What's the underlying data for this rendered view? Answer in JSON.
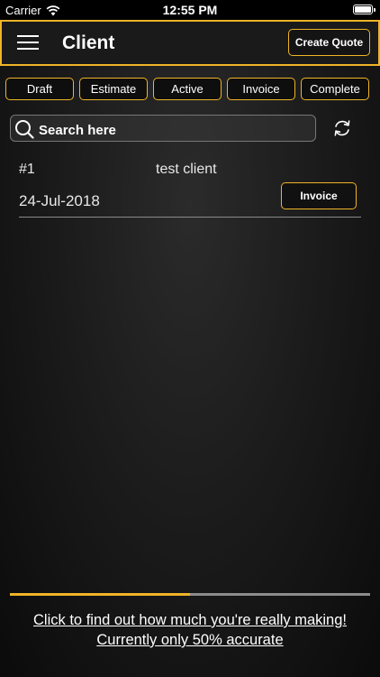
{
  "status_bar": {
    "carrier": "Carrier",
    "time": "12:55 PM",
    "icons": [
      "wifi-icon",
      "battery-icon"
    ]
  },
  "header": {
    "title": "Client",
    "menu_icon": "hamburger-menu-icon",
    "create_quote_label": "Create Quote"
  },
  "filters": {
    "tabs": [
      {
        "label": "Draft"
      },
      {
        "label": "Estimate"
      },
      {
        "label": "Active"
      },
      {
        "label": "Invoice"
      },
      {
        "label": "Complete"
      }
    ]
  },
  "search": {
    "placeholder": "Search here",
    "value": "",
    "icon": "search-icon",
    "refresh_icon": "refresh-icon"
  },
  "clients": [
    {
      "number": "#1",
      "name": "test client",
      "date": "24-Jul-2018",
      "action_label": "Invoice"
    }
  ],
  "footer": {
    "line1": "Click to find out how much you're really making!",
    "line2": "Currently only 50% accurate",
    "accuracy_progress": 0.5
  },
  "colors": {
    "accent": "#f0b428",
    "background": "#1c1c1c",
    "text": "#ffffff",
    "progress_track": "#8c8c8c"
  }
}
